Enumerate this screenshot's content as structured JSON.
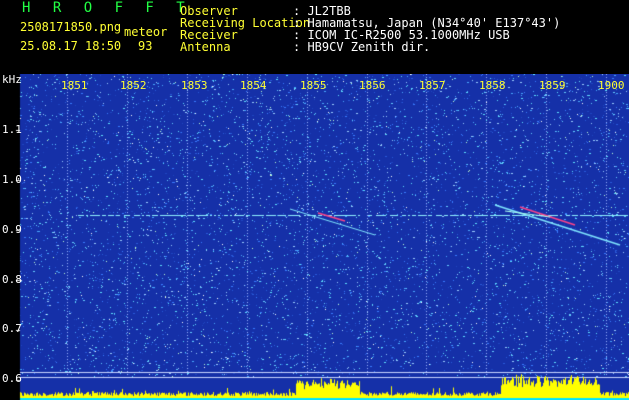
{
  "header": {
    "logo": "H R O F F T",
    "filename": "2508171850.png",
    "mode": "meteor",
    "datetime": "25.08.17 18:50",
    "count": "93",
    "info": [
      {
        "key": "Observer",
        "value": ": JL2TBB"
      },
      {
        "key": "Receiving Location",
        "value": ": Hamamatsu, Japan (N34°40' E137°43')"
      },
      {
        "key": "Receiver",
        "value": ": ICOM IC-R2500 53.1000MHz USB"
      },
      {
        "key": "Antenna",
        "value": ": HB9CV Zenith dir."
      }
    ]
  },
  "chart_data": {
    "type": "heatmap",
    "ylabel": "kHz",
    "x_ticks": [
      "1851",
      "1852",
      "1853",
      "1854",
      "1855",
      "1856",
      "1857",
      "1858",
      "1859",
      "1900"
    ],
    "y_ticks": [
      "1.1",
      "1.0",
      "0.9",
      "0.8",
      "0.7",
      "0.6"
    ],
    "ylim": [
      0.58,
      1.18
    ],
    "carrier_khz": 0.93,
    "grid": true,
    "colors": {
      "background": "#1530a8",
      "noise": "#4aa8ff",
      "carrier": "#8ff0ff",
      "echo": "#ff4488",
      "bottom_bars": "#ffff00",
      "grid": "#9ab0ff"
    }
  }
}
